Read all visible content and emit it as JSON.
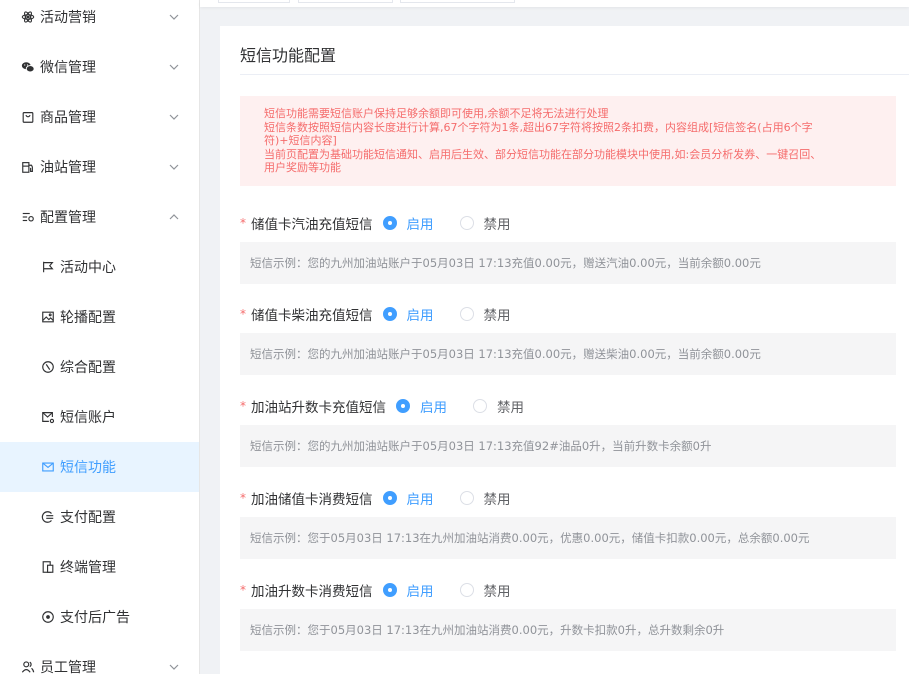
{
  "sidebar": {
    "items": [
      {
        "label": "活动营销",
        "icon": "atom-icon",
        "expanded": false
      },
      {
        "label": "微信管理",
        "icon": "wechat-icon",
        "expanded": false
      },
      {
        "label": "商品管理",
        "icon": "shopping-bag-icon",
        "expanded": false
      },
      {
        "label": "油站管理",
        "icon": "gas-station-icon",
        "expanded": false
      },
      {
        "label": "配置管理",
        "icon": "settings-list-icon",
        "expanded": true
      },
      {
        "label": "员工管理",
        "icon": "users-icon",
        "expanded": false
      }
    ],
    "sub_items": [
      {
        "label": "活动中心",
        "icon": "flag-icon"
      },
      {
        "label": "轮播配置",
        "icon": "image-icon"
      },
      {
        "label": "综合配置",
        "icon": "compass-icon"
      },
      {
        "label": "短信账户",
        "icon": "mail-settings-icon"
      },
      {
        "label": "短信功能",
        "icon": "mail-icon",
        "active": true
      },
      {
        "label": "支付配置",
        "icon": "payment-icon"
      },
      {
        "label": "终端管理",
        "icon": "terminal-icon"
      },
      {
        "label": "支付后广告",
        "icon": "circle-dot-icon"
      }
    ]
  },
  "colors": {
    "accent": "#409eff",
    "danger": "#f56c6c",
    "alert_bg": "#fef0f0",
    "active_bg": "#e8f4ff"
  },
  "main": {
    "title": "短信功能配置",
    "alert": {
      "line1": "短信功能需要短信账户保持足够余额即可使用,余额不足将无法进行处理",
      "line2": "短信条数按照短信内容长度进行计算,67个字符为1条,超出67字符将按照2条扣费，内容组成[短信签名(占用6个字",
      "line3": "符)+短信内容]",
      "line4": "当前页配置为基础功能短信通知、启用后生效、部分短信功能在部分功能模块中使用,如:会员分析发券、一键召回、",
      "line5": "用户奖励等功能"
    },
    "enable_label": "启用",
    "disable_label": "禁用",
    "settings": [
      {
        "label": "储值卡汽油充值短信",
        "enabled": true,
        "example": "短信示例：您的九州加油站账户于05月03日 17:13充值0.00元，赠送汽油0.00元，当前余额0.00元"
      },
      {
        "label": "储值卡柴油充值短信",
        "enabled": true,
        "example": "短信示例：您的九州加油站账户于05月03日 17:13充值0.00元，赠送柴油0.00元，当前余额0.00元"
      },
      {
        "label": "加油站升数卡充值短信",
        "enabled": true,
        "example": "短信示例：您的九州加油站账户于05月03日 17:13充值92#油品0升，当前升数卡余额0升"
      },
      {
        "label": "加油储值卡消费短信",
        "enabled": true,
        "example": "短信示例：您于05月03日 17:13在九州加油站消费0.00元，优惠0.00元，储值卡扣款0.00元，总余额0.00元"
      },
      {
        "label": "加油升数卡消费短信",
        "enabled": true,
        "example": "短信示例：您于05月03日 17:13在九州加油站消费0.00元，升数卡扣款0升，总升数剩余0升"
      }
    ]
  }
}
